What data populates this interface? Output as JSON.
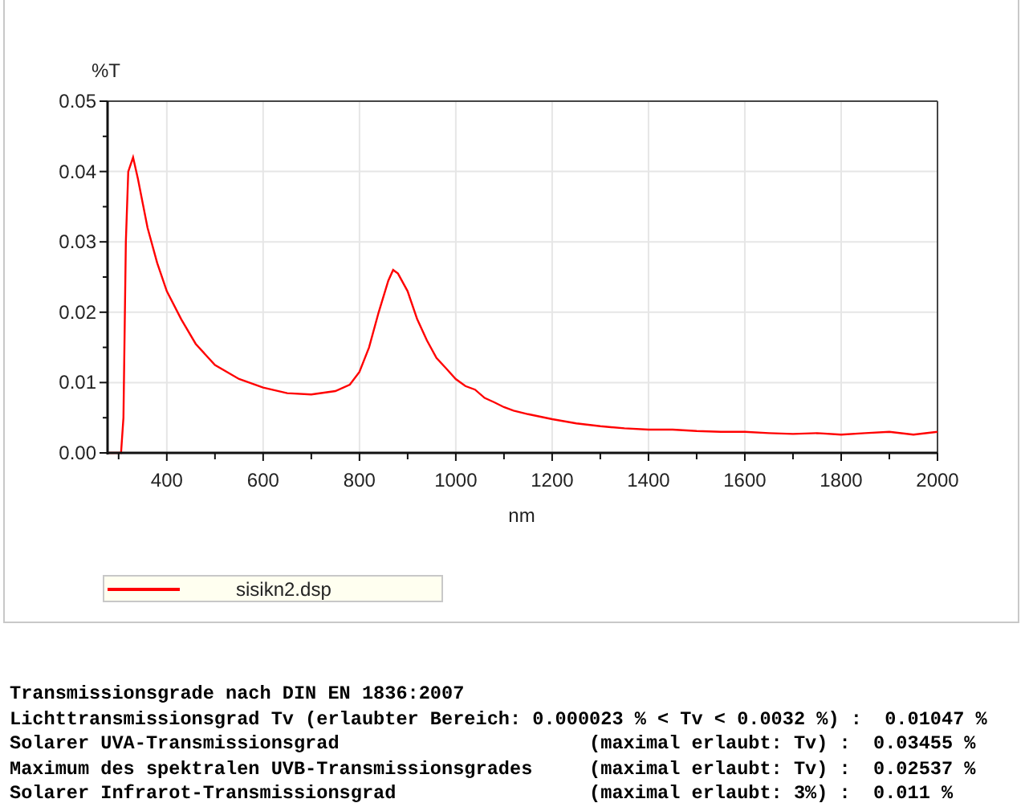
{
  "chart": {
    "chart_data": {
      "type": "line",
      "grid": true,
      "xlabel": "nm",
      "ylabel": "%T",
      "xlim": [
        277,
        2000
      ],
      "ylim": [
        0,
        0.05
      ],
      "xticks": [
        400,
        600,
        800,
        1000,
        1200,
        1400,
        1600,
        1800,
        2000
      ],
      "yticks": [
        {
          "value": 0,
          "label": "0.00"
        },
        {
          "value": 0.01,
          "label": "0.01"
        },
        {
          "value": 0.02,
          "label": "0.02"
        },
        {
          "value": 0.03,
          "label": "0.03"
        },
        {
          "value": 0.04,
          "label": "0.04"
        },
        {
          "value": 0.05,
          "label": "0.05"
        }
      ],
      "x": [
        280,
        290,
        300,
        305,
        310,
        315,
        320,
        330,
        340,
        360,
        380,
        400,
        430,
        460,
        500,
        550,
        600,
        650,
        700,
        750,
        780,
        800,
        820,
        840,
        860,
        870,
        880,
        900,
        920,
        940,
        960,
        980,
        1000,
        1020,
        1040,
        1060,
        1080,
        1100,
        1120,
        1150,
        1200,
        1250,
        1300,
        1350,
        1400,
        1450,
        1500,
        1550,
        1600,
        1650,
        1700,
        1750,
        1800,
        1850,
        1900,
        1950,
        2000
      ],
      "series": [
        {
          "name": "sisikn2.dsp",
          "color": "#ff0000",
          "values": [
            0,
            0,
            0,
            0,
            0.005,
            0.03,
            0.04,
            0.042,
            0.039,
            0.032,
            0.027,
            0.023,
            0.019,
            0.0155,
            0.0125,
            0.0105,
            0.0093,
            0.0085,
            0.0083,
            0.0088,
            0.0097,
            0.0115,
            0.015,
            0.02,
            0.0245,
            0.026,
            0.0255,
            0.023,
            0.019,
            0.016,
            0.0135,
            0.012,
            0.0105,
            0.0095,
            0.009,
            0.0078,
            0.0072,
            0.0065,
            0.006,
            0.0055,
            0.0048,
            0.0042,
            0.0038,
            0.0035,
            0.0033,
            0.0033,
            0.0031,
            0.003,
            0.003,
            0.0028,
            0.0027,
            0.0028,
            0.0026,
            0.0028,
            0.003,
            0.0026,
            0.003
          ]
        }
      ]
    }
  },
  "results": [
    "Transmissionsgrade nach DIN EN 1836:2007",
    "Lichttransmissionsgrad Tv (erlaubter Bereich: 0.000023 % < Tv < 0.0032 %) :  0.01047 %",
    "Solarer UVA-Transmissionsgrad                      (maximal erlaubt: Tv) :  0.03455 %",
    "Maximum des spektralen UVB-Transmissionsgrades     (maximal erlaubt: Tv) :  0.02537 %",
    "Solarer Infrarot-Transmissionsgrad                 (maximal erlaubt: 3%) :  0.011 %"
  ]
}
